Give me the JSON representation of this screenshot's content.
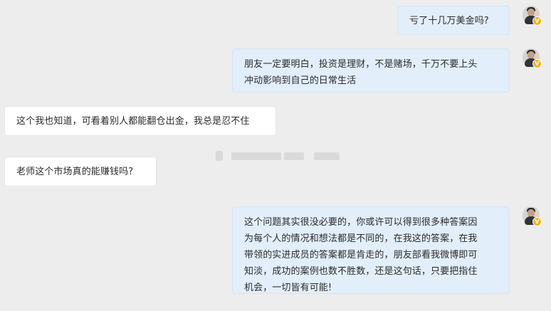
{
  "chat": {
    "messages": [
      {
        "side": "right",
        "text": "亏了十几万美金吗?"
      },
      {
        "side": "right",
        "text": "朋友一定要明白，投资是理财，不是赌场，千万不要上头\n冲动影响到自己的日常生活"
      },
      {
        "side": "left",
        "text": "这个我也知道，可看着别人都能翻仓出金，我总是忍不住"
      },
      {
        "side": "left",
        "text": "老师这个市场真的能赚钱吗?"
      },
      {
        "side": "right",
        "text": "这个问题其实很没必要的，你或许可以得到很多种答案因\n为每个人的情况和想法都是不同的，在我这的答案，在我\n带领的实进成员的答案都是肯走的，朋友部看我微博即可\n知淡，成功的案例也数不胜数，还是这句话，只要把指住\n机会，一切皆有可能!"
      }
    ],
    "avatar": {
      "icon": "user-avatar-icon",
      "badge": "V",
      "badge_color": "#f3b21c"
    },
    "colors": {
      "background": "#ededed",
      "right_bubble": "#e2eef9",
      "left_bubble": "#ffffff"
    }
  }
}
